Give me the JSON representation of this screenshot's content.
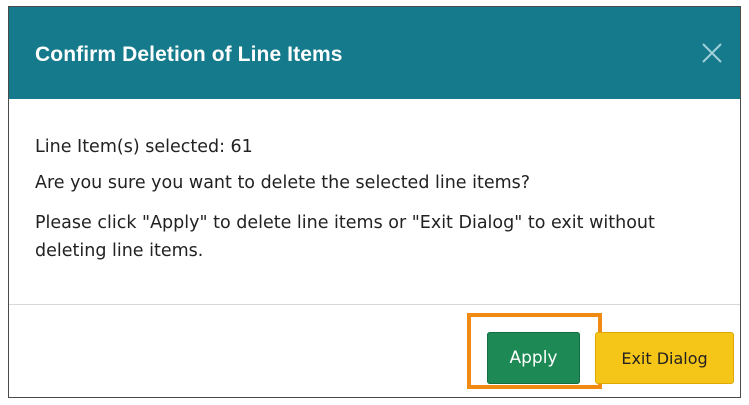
{
  "dialog": {
    "title": "Confirm Deletion of Line Items",
    "close_icon": "close-icon",
    "selected_text": "Line Item(s) selected: 61",
    "question": "Are you sure you want to delete the selected line items?",
    "instruction": "Please click \"Apply\" to delete line items or \"Exit Dialog\" to exit without deleting line items.",
    "buttons": {
      "apply_label": "Apply",
      "exit_label": "Exit Dialog"
    }
  },
  "colors": {
    "header": "#147a8c",
    "apply": "#1d8a55",
    "exit": "#f5c518",
    "highlight": "#f08a12"
  }
}
